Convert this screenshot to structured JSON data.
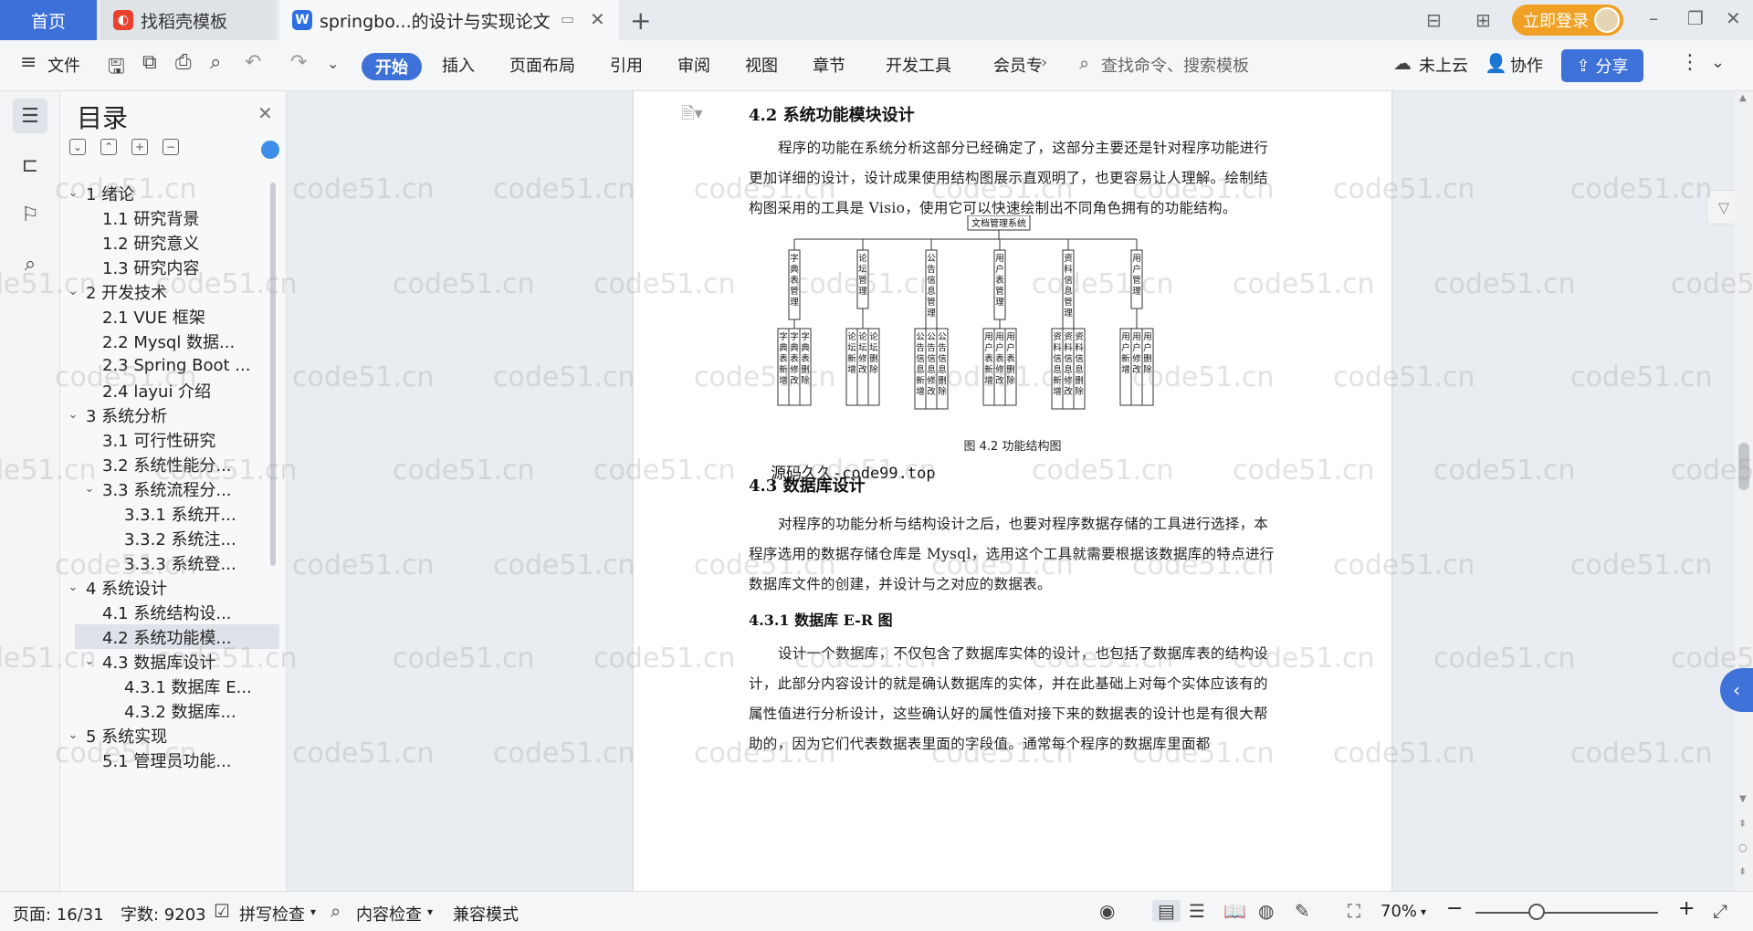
{
  "titlebar": {
    "tabs": [
      {
        "label": "首页"
      },
      {
        "label": "找稻壳模板"
      },
      {
        "label": "springbo...的设计与实现论文"
      }
    ],
    "login_label": "立即登录"
  },
  "ribbon": {
    "file_label": "文件",
    "tabs": [
      "开始",
      "插入",
      "页面布局",
      "引用",
      "审阅",
      "视图",
      "章节",
      "开发工具",
      "会员专"
    ],
    "search_placeholder": "查找命令、搜索模板",
    "cloud_label": "未上云",
    "collab_label": "协作",
    "share_label": "分享"
  },
  "toc": {
    "title": "目录",
    "items": [
      {
        "label": "1  绪论",
        "level": 1,
        "arrow": "v"
      },
      {
        "label": "1.1  研究背景",
        "level": 2,
        "arrow": ""
      },
      {
        "label": "1.2  研究意义",
        "level": 2,
        "arrow": ""
      },
      {
        "label": "1.3  研究内容",
        "level": 2,
        "arrow": ""
      },
      {
        "label": "2  开发技术",
        "level": 1,
        "arrow": "v"
      },
      {
        "label": "2.1 VUE 框架",
        "level": 2,
        "arrow": ""
      },
      {
        "label": "2.2 Mysql 数据...",
        "level": 2,
        "arrow": ""
      },
      {
        "label": "2.3 Spring Boot ...",
        "level": 2,
        "arrow": ""
      },
      {
        "label": "2.4 layui 介绍",
        "level": 2,
        "arrow": ""
      },
      {
        "label": "3  系统分析",
        "level": 1,
        "arrow": "v"
      },
      {
        "label": "3.1 可行性研究",
        "level": 2,
        "arrow": ""
      },
      {
        "label": "3.2 系统性能分...",
        "level": 2,
        "arrow": ""
      },
      {
        "label": "3.3  系统流程分...",
        "level": 2,
        "arrow": "v"
      },
      {
        "label": "3.3.1  系统开...",
        "level": 3,
        "arrow": ""
      },
      {
        "label": "3.3.2  系统注...",
        "level": 3,
        "arrow": ""
      },
      {
        "label": "3.3.3  系统登...",
        "level": 3,
        "arrow": ""
      },
      {
        "label": "4  系统设计",
        "level": 1,
        "arrow": "v"
      },
      {
        "label": "4.1  系统结构设...",
        "level": 2,
        "arrow": ""
      },
      {
        "label": "4.2 系统功能模...",
        "level": 2,
        "arrow": "",
        "selected": true
      },
      {
        "label": "4.3 数据库设计",
        "level": 2,
        "arrow": "v"
      },
      {
        "label": "4.3.1 数据库 E...",
        "level": 3,
        "arrow": ""
      },
      {
        "label": "4.3.2  数据库...",
        "level": 3,
        "arrow": ""
      },
      {
        "label": "5  系统实现",
        "level": 1,
        "arrow": "v"
      },
      {
        "label": "5.1  管理员功能...",
        "level": 2,
        "arrow": ""
      }
    ]
  },
  "document": {
    "heading_42": "4.2 系统功能模块设计",
    "para_42": "程序的功能在系统分析这部分已经确定了，这部分主要还是针对程序功能进行更加详细的设计，设计成果使用结构图展示直观明了，也更容易让人理解。绘制结构图采用的工具是 Visio，使用它可以快速绘制出不同角色拥有的功能结构。",
    "diagram": {
      "root": "文档管理系统",
      "modules": [
        {
          "name": "字典表管理",
          "children": [
            "字典表新增",
            "字典表修改",
            "字典表删除"
          ]
        },
        {
          "name": "论坛管理",
          "children": [
            "论坛新增",
            "论坛修改",
            "论坛删除"
          ]
        },
        {
          "name": "公告信息管理",
          "children": [
            "公告信息新增",
            "公告信息修改",
            "公告信息删除"
          ]
        },
        {
          "name": "用户表管理",
          "children": [
            "用户表新增",
            "用户表修改",
            "用户表删除"
          ]
        },
        {
          "name": "资料信息管理",
          "children": [
            "资料信息新增",
            "资料信息修改",
            "资料信息删除"
          ]
        },
        {
          "name": "用户管理",
          "children": [
            "用户新增",
            "用户修改",
            "用户删除"
          ]
        }
      ]
    },
    "caption": "图 4.2  功能结构图",
    "overlay_text": "源码久久-code99.top",
    "heading_43": "4.3 数据库设计",
    "para_43": "对程序的功能分析与结构设计之后，也要对程序数据存储的工具进行选择，本程序选用的数据存储仓库是 Mysql，选用这个工具就需要根据该数据库的特点进行数据库文件的创建，并设计与之对应的数据表。",
    "heading_431": "4.3.1 数据库 E-R 图",
    "para_431": "设计一个数据库，不仅包含了数据库实体的设计，也包括了数据库表的结构设计，此部分内容设计的就是确认数据库的实体，并在此基础上对每个实体应该有的属性值进行分析设计，这些确认好的属性值对接下来的数据表的设计也是有很大帮助的，因为它们代表数据表里面的字段值。通常每个程序的数据库里面都"
  },
  "statusbar": {
    "page": "页面: 16/31",
    "words": "字数: 9203",
    "spell": "拼写检查",
    "content_check": "内容检查",
    "compat": "兼容模式",
    "zoom": "70%"
  },
  "watermark": "code51.cn"
}
